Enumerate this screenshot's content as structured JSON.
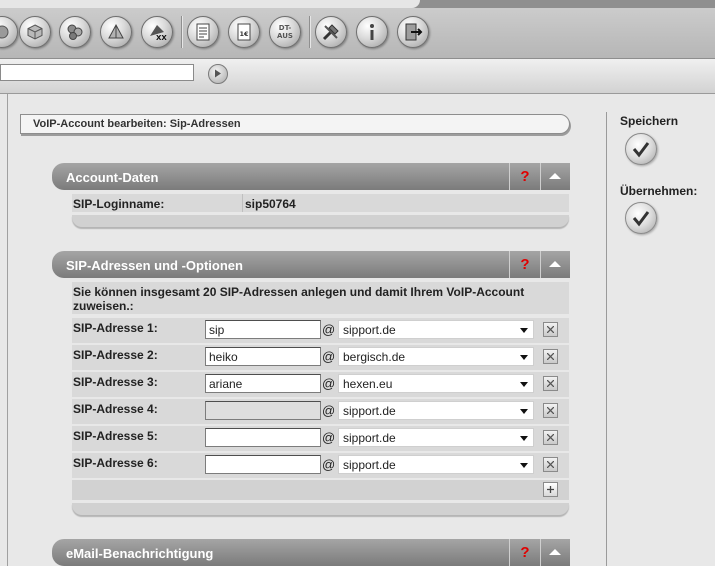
{
  "toolbar": {
    "icons": [
      "disc-icon",
      "box-icon",
      "people-icon",
      "triangle-icon",
      "xxl-icon",
      "document-icon",
      "invoice-euro-icon",
      "dt-aus-icon",
      "tools-icon",
      "info-icon",
      "logout-icon"
    ],
    "invoice_label": "1€",
    "dt_aus_label_1": "DT-",
    "dt_aus_label_2": "AUS",
    "xx_label": "XX",
    "address_value": ""
  },
  "breadcrumb": "VoIP-Account bearbeiten: Sip-Adressen",
  "account_section": {
    "title": "Account-Daten",
    "help": "?",
    "login_label": "SIP-Loginname:",
    "login_value": "sip50764"
  },
  "sip_section": {
    "title": "SIP-Adressen und -Optionen",
    "help": "?",
    "info_text": "Sie können insgesamt 20 SIP-Adressen anlegen und damit Ihrem VoIP-Account zuweisen.:",
    "at_sign": "@",
    "rows": [
      {
        "label": "SIP-Adresse 1:",
        "user": "sip",
        "domain": "sipport.de"
      },
      {
        "label": "SIP-Adresse 2:",
        "user": "heiko",
        "domain": "bergisch.de"
      },
      {
        "label": "SIP-Adresse 3:",
        "user": "ariane",
        "domain": "hexen.eu"
      },
      {
        "label": "SIP-Adresse 4:",
        "user": "",
        "domain": "sipport.de"
      },
      {
        "label": "SIP-Adresse 5:",
        "user": "",
        "domain": "sipport.de"
      },
      {
        "label": "SIP-Adresse 6:",
        "user": "",
        "domain": "sipport.de"
      }
    ]
  },
  "email_section": {
    "title": "eMail-Benachrichtigung",
    "help": "?"
  },
  "sidebar": {
    "save_label": "Speichern",
    "apply_label": "Übernehmen:"
  },
  "colors": {
    "header_gray": "#8f8f8f",
    "help_red": "#e00000",
    "panel_bg": "#d9d9d9"
  }
}
